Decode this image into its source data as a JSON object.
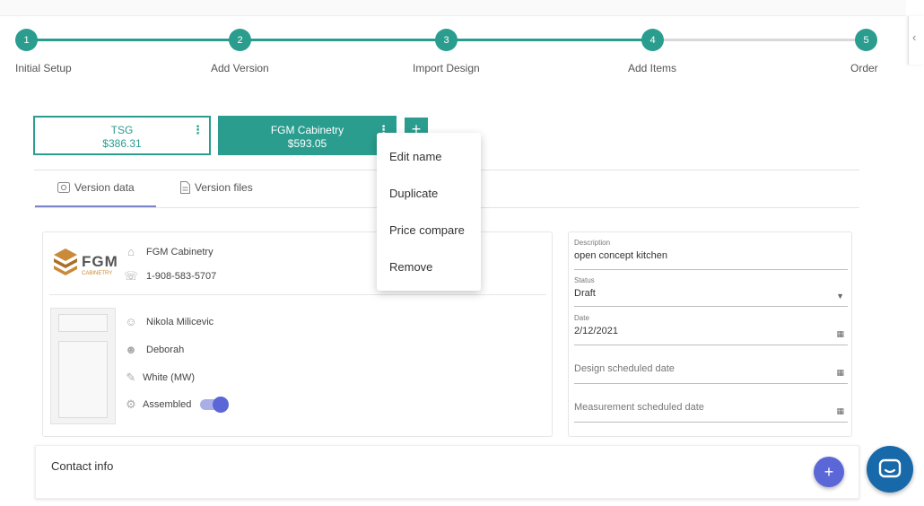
{
  "stepper": {
    "steps": [
      {
        "number": "1",
        "label": "Initial Setup"
      },
      {
        "number": "2",
        "label": "Add Version"
      },
      {
        "number": "3",
        "label": "Import Design"
      },
      {
        "number": "4",
        "label": "Add Items"
      },
      {
        "number": "5",
        "label": "Order"
      }
    ],
    "active_color": "#2a9d8f",
    "inactive_color": "#d9d9d9"
  },
  "versions": [
    {
      "name": "TSG",
      "price": "$386.31",
      "selected": false
    },
    {
      "name": "FGM Cabinetry",
      "price": "$593.05",
      "selected": true
    }
  ],
  "add_version_label": "+",
  "version_menu": {
    "items": [
      "Edit name",
      "Duplicate",
      "Price compare",
      "Remove"
    ]
  },
  "tabs": [
    {
      "label": "Version data",
      "icon": "version-data-icon",
      "active": true
    },
    {
      "label": "Version files",
      "icon": "file-icon",
      "active": false
    }
  ],
  "info": {
    "brand_logo": {
      "text": "FGM",
      "sub": "CABINETRY"
    },
    "company": "FGM Cabinetry",
    "phone": "1-908-583-5707",
    "designer": "Nikola Milicevic",
    "customer": "Deborah",
    "finish": "White (MW)",
    "assembled_label": "Assembled",
    "assembled_on": true
  },
  "form": {
    "description_label": "Description",
    "description_value": "open concept kitchen",
    "status_label": "Status",
    "status_value": "Draft",
    "date_label": "Date",
    "date_value": "2/12/2021",
    "design_date_placeholder": "Design scheduled date",
    "measurement_date_placeholder": "Measurement scheduled date"
  },
  "contact": {
    "title": "Contact info"
  },
  "fab_label": "+",
  "colors": {
    "accent": "#2a9d8f",
    "indigo": "#5b67d6",
    "chat": "#1769aa"
  }
}
